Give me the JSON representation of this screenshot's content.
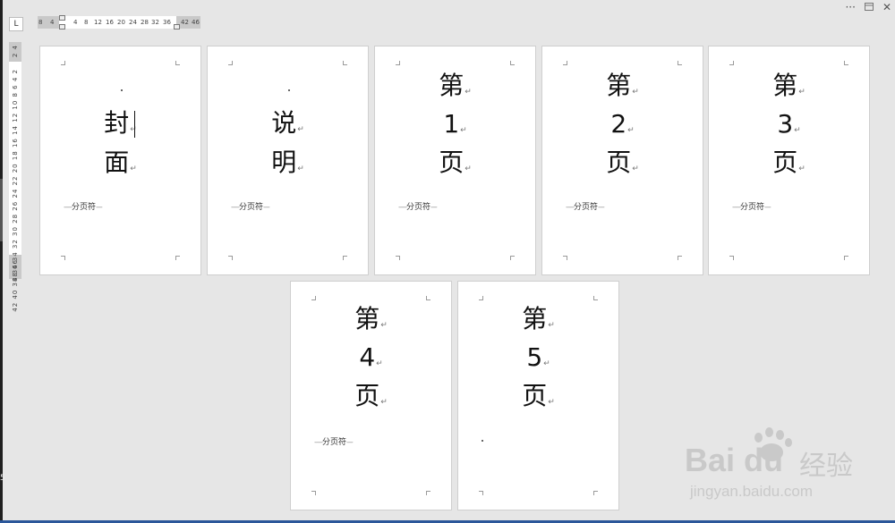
{
  "window": {
    "more_icon": "more-icon",
    "layout_icon": "layout-icon",
    "close_label": "✕"
  },
  "ruler": {
    "tab_selector": "L",
    "horizontal_ticks": [
      "8",
      "4",
      "4",
      "8",
      "12",
      "16",
      "20",
      "24",
      "28",
      "32",
      "36",
      "42",
      "46"
    ],
    "vertical_top": "2 4",
    "vertical_main": "42 40 38 36 34 32 30 28 26 24 22 20 18 16 14 12 10 8 6 4 2",
    "vertical_bottom": "48 46"
  },
  "pages": [
    {
      "id": "cover",
      "lines": [
        "封",
        "面"
      ],
      "page_break": "分页符"
    },
    {
      "id": "instructions",
      "lines": [
        "说",
        "明"
      ],
      "page_break": "分页符"
    },
    {
      "id": "page1",
      "lines": [
        "第",
        "1",
        "页"
      ],
      "page_break": "分页符"
    },
    {
      "id": "page2",
      "lines": [
        "第",
        "2",
        "页"
      ],
      "page_break": "分页符"
    },
    {
      "id": "page3",
      "lines": [
        "第",
        "3",
        "页"
      ],
      "page_break": "分页符"
    },
    {
      "id": "page4",
      "lines": [
        "第",
        "4",
        "页"
      ],
      "page_break": "分页符"
    },
    {
      "id": "page5",
      "lines": [
        "第",
        "5",
        "页"
      ],
      "page_break": ""
    }
  ],
  "watermark": {
    "logo": "Bai du",
    "cn": "经验",
    "url": "jingyan.baidu.com"
  },
  "left_edge_number": "5",
  "colors": {
    "background": "#e6e6e6",
    "page": "#ffffff",
    "accent": "#2b579a"
  }
}
